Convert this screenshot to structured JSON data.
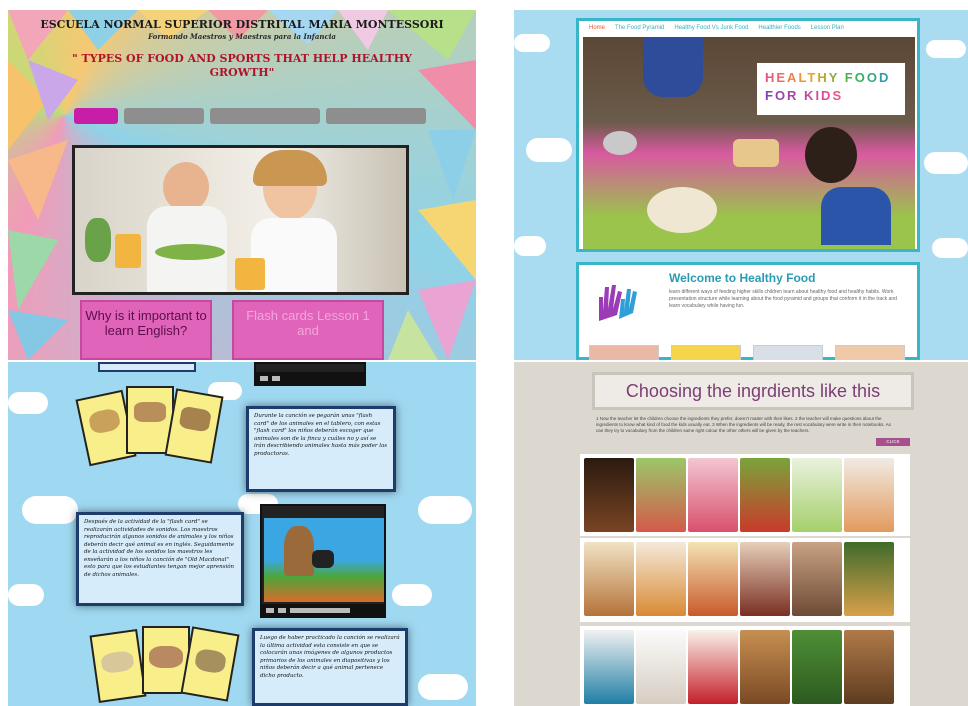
{
  "panel1": {
    "school": "ESCUELA NORMAL SUPERIOR DISTRITAL MARIA MONTESSORI",
    "subtitle": "Formando Maestros y Maestras para la Infancia",
    "title": "\" TYPES OF FOOD AND SPORTS THAT HELP HEALTHY GROWTH\"",
    "box_left": "Why is it important to learn English?",
    "box_right": "Flash cards Lesson 1 and",
    "colors": {
      "accent": "#c81ea7",
      "title": "#b0122a",
      "box": "#e064b9"
    }
  },
  "panel2": {
    "menu": [
      "Home",
      "The Food Pyramid",
      "Healthy Food Vs Junk Food",
      "Healthier Foods",
      "Lesson Plan"
    ],
    "logo_line1": "HEALTHY FOOD",
    "logo_line2": "FOR KIDS",
    "welcome_title": "Welcome to Healthy Food",
    "welcome_text": "learn different ways of feeding higher skills children learn about healthy food and healthy habits. Work presentation structure while learning about the food pyramid and groups that conform it in the track and learn vocabulary while having fun.",
    "colors": {
      "frame": "#38b5c7",
      "background": "#a9dcf0"
    }
  },
  "panel3": {
    "text_top": "Durante la canción se pegarán unas \"flash card\" de los animales en el tablero, con estas \"flash card\" los niños deberán escoger que animales son de la finca y cuáles no y así se irán describiendo animales hasta más poder las productoras.",
    "text_mid": "Después de la actividad de la \"flash card\" se realizarán actividades de sonidos. Los maestros reproducirán algunos sonidos de animales y los niños deberán decir qué animal es en inglés. Seguidamente de la actividad de los sonidos los maestros les enseñarán a los niños la canción de \"Old Macdonal\" esto para que los estudiantes tengan mejor aprensión de dichos animales.",
    "text_bottom": "Luego de haber practicado la canción se realizará la última actividad esta consiste en que se colocarán unas imágenes de algunos productos primarios de los animales en diapositivas y los niños deberán decir a qué animal pertenece dicho producto.",
    "colors": {
      "box": "#d6ecfa",
      "border": "#1d3b6b"
    }
  },
  "panel4": {
    "header": "Choosing the ingrdients like this",
    "instructions": "1 Now the teacher let the children choose the ingredients they prefer, doesn't matter with their likes. 2 the teacher will make questions about the ingredients to know what kind of food the kids usually eat. 3 When the ingredients will be ready, the rest vocabulary were write in their notebooks. As can they try to vocabulary from the children same right colour the other others will be given by the teachers.",
    "button": "CLICK",
    "colors": {
      "header_text": "#7b3e73",
      "button": "#a8508f"
    }
  }
}
